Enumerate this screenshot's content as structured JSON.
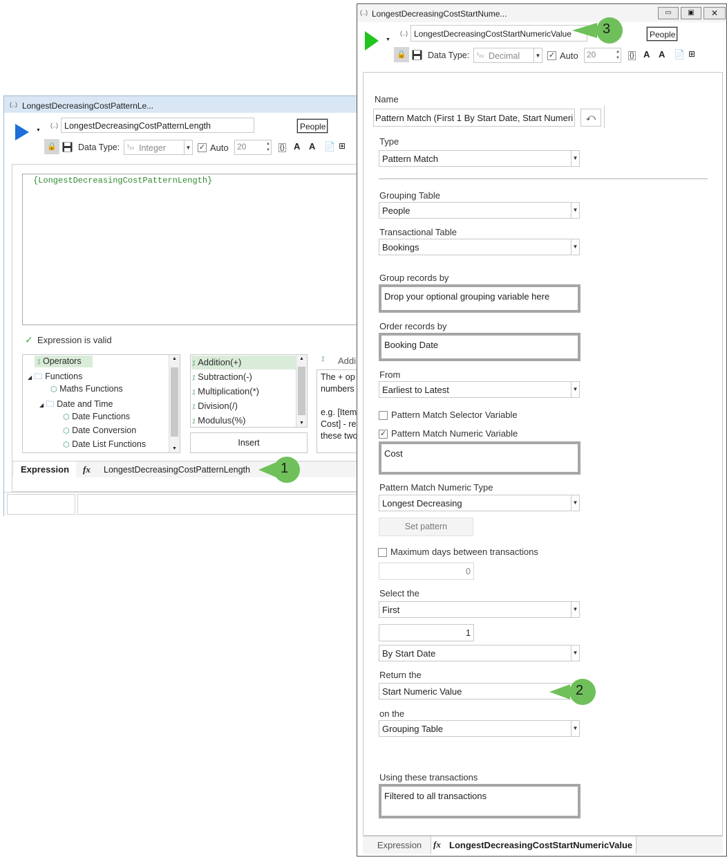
{
  "left_window": {
    "title": "LongestDecreasingCostPatternLe...",
    "title_icon": "(..)",
    "name_value": "LongestDecreasingCostPatternLength",
    "people_button": "People",
    "data_type_label": "Data Type:",
    "data_type_value": "Integer",
    "data_type_prefix": "¹₂₃",
    "auto_label": "Auto",
    "auto_checked": true,
    "size_value": "20",
    "expression_text": "{LongestDecreasingCostPatternLength}",
    "validity": "Expression is valid",
    "tree": [
      {
        "label": "Operators",
        "icon": "operator-icon"
      },
      {
        "label": "Functions",
        "icon": "folder-icon"
      },
      {
        "label": "Maths Functions",
        "icon": "cube-icon"
      },
      {
        "label": "Date and Time",
        "icon": "folder-icon"
      },
      {
        "label": "Date Functions",
        "icon": "cube-icon"
      },
      {
        "label": "Date Conversion",
        "icon": "cube-icon"
      },
      {
        "label": "Date List Functions",
        "icon": "cube-icon"
      }
    ],
    "operators": [
      "Addition(+)",
      "Subtraction(-)",
      "Multiplication(*)",
      "Division(/)",
      "Modulus(%)"
    ],
    "insert_button": "Insert",
    "help_title": "Addi",
    "help_lines": [
      "The + op",
      "numbers",
      "",
      "e.g. [Item",
      "Cost] - re",
      "these two"
    ],
    "bottom_tab_expression": "Expression",
    "fx": "fx",
    "bottom_tab_name": "LongestDecreasingCostPatternLength"
  },
  "right_window": {
    "title": "LongestDecreasingCostStartNume...",
    "title_icon": "(..)",
    "name_value": "LongestDecreasingCostStartNumericValue",
    "people_button": "People",
    "data_type_label": "Data Type:",
    "data_type_value": "Decimal",
    "data_type_prefix": "¹₂₃",
    "auto_label": "Auto",
    "auto_checked": true,
    "size_value": "20",
    "form": {
      "name_label": "Name",
      "name_value": "Pattern Match (First 1 By Start Date, Start Numeri",
      "type_label": "Type",
      "type_value": "Pattern Match",
      "grouping_table_label": "Grouping Table",
      "grouping_table_value": "People",
      "transactional_table_label": "Transactional Table",
      "transactional_table_value": "Bookings",
      "group_records_label": "Group records by",
      "group_records_placeholder": "Drop your optional grouping variable here",
      "order_records_label": "Order records by",
      "order_records_value": "Booking Date",
      "from_label": "From",
      "from_value": "Earliest to Latest",
      "selector_variable_label": "Pattern Match Selector Variable",
      "selector_variable_checked": false,
      "numeric_variable_label": "Pattern Match Numeric Variable",
      "numeric_variable_checked": true,
      "numeric_variable_value": "Cost",
      "numeric_type_label": "Pattern Match Numeric Type",
      "numeric_type_value": "Longest Decreasing",
      "set_pattern_button": "Set pattern",
      "max_days_label": "Maximum days between transactions",
      "max_days_checked": false,
      "max_days_value": "0",
      "select_the_label": "Select the",
      "select_the_value": "First",
      "count_value": "1",
      "by_value": "By Start Date",
      "return_the_label": "Return the",
      "return_the_value": "Start Numeric Value",
      "on_the_label": "on the",
      "on_the_value": "Grouping Table",
      "using_label": "Using these transactions",
      "using_value": "Filtered to all transactions"
    },
    "bottom_tab_expression": "Expression",
    "fx": "fx",
    "bottom_tab_name": "LongestDecreasingCostStartNumericValue"
  },
  "callouts": [
    "1",
    "2",
    "3"
  ],
  "colors": {
    "callout_green": "#6fc05a",
    "play_blue": "#1e6fd9",
    "play_green": "#22c41e",
    "expression_green": "#2e8b2e",
    "window_border": "#9ab9d6"
  }
}
